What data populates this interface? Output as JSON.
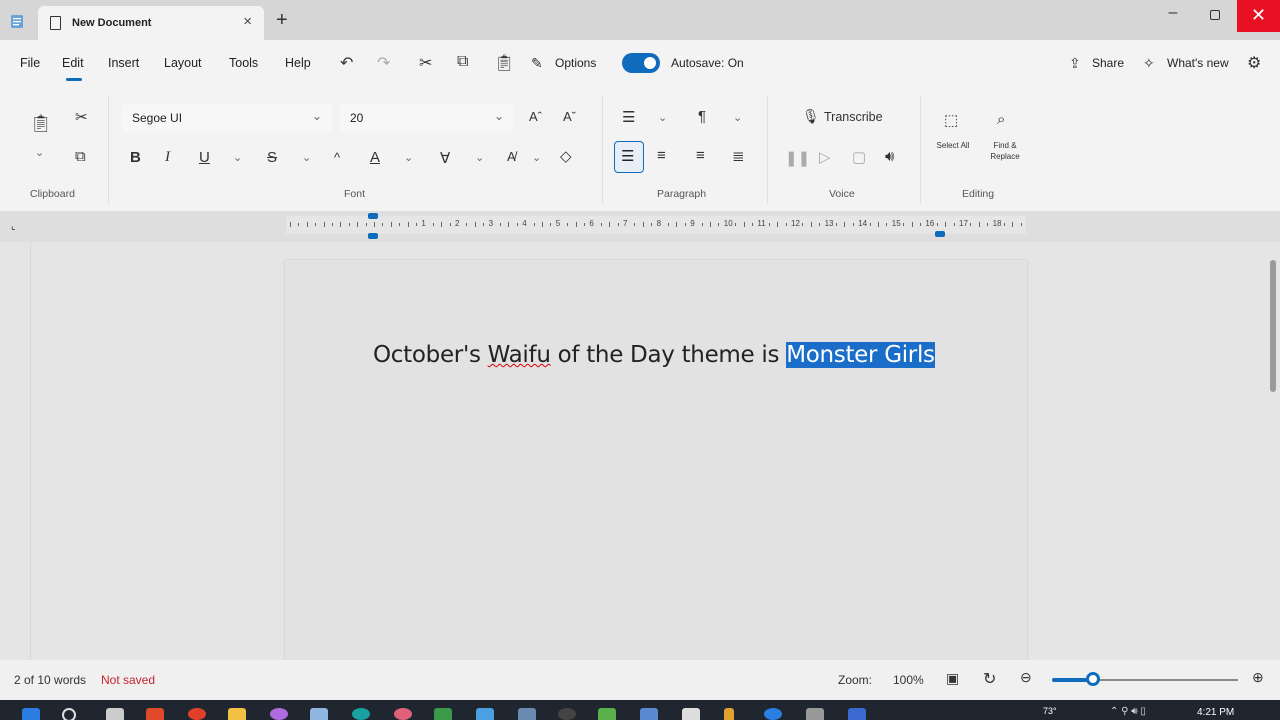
{
  "window": {
    "tab_title": "New Document",
    "close_tab": "×",
    "new_tab": "+",
    "minimize": "–",
    "close": "✕"
  },
  "menubar": {
    "items": [
      "File",
      "Edit",
      "Insert",
      "Layout",
      "Tools",
      "Help"
    ],
    "active": "Edit",
    "options_label": "Options",
    "autosave_label": "Autosave: On",
    "autosave_on": true,
    "share_label": "Share",
    "whats_new_label": "What's new"
  },
  "ribbon": {
    "font_family": "Segoe UI",
    "font_size": "20",
    "transcribe_label": "Transcribe",
    "select_all_label": "Select All",
    "find_replace_label": "Find & Replace",
    "groups": {
      "clipboard": "Clipboard",
      "font": "Font",
      "paragraph": "Paragraph",
      "voice": "Voice",
      "editing": "Editing"
    }
  },
  "document": {
    "text_before": "October's ",
    "text_misspelled": "Waifu",
    "text_middle": " of the Day theme is ",
    "text_selected": "Monster Girls"
  },
  "status": {
    "word_count": "2 of 10 words",
    "save_state": "Not saved",
    "zoom_label": "Zoom:",
    "zoom_value": "100%",
    "zoom_level": 0.22
  },
  "taskbar": {
    "temp": "73°",
    "time": "4:21 PM"
  },
  "colors": {
    "accent": "#0f6cbd",
    "selection": "#1a6dc8",
    "close_red": "#e81123",
    "not_saved": "#c4262e"
  }
}
